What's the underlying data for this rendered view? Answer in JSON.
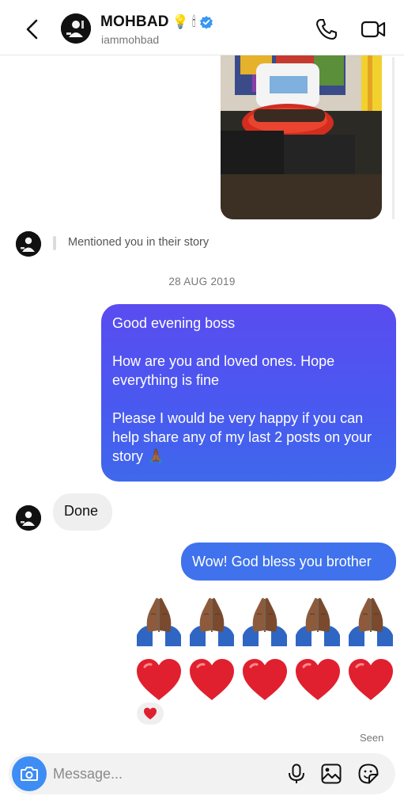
{
  "header": {
    "name": "MOHBAD",
    "name_emojis": [
      "💡",
      "🕯"
    ],
    "username": "iammohbad",
    "back_icon": "chevron-left-icon",
    "call_icon": "phone-icon",
    "video_icon": "video-camera-icon",
    "verified_color": "#3897f0"
  },
  "story": {
    "mention_text": "Mentioned you in their story"
  },
  "date_label": "28 AUG 2019",
  "messages": {
    "msg1": "Good evening boss\n\nHow are you and loved ones. Hope everything is fine\n\nPlease I would be very happy if you can help share any of my last 2 posts on your story 🙏🏾",
    "msg2": "Done",
    "msg3": "Wow! God bless you brother"
  },
  "emoji_rows": {
    "pray_count": 5,
    "heart_count": 5,
    "pray_icon": "praying-hands-icon",
    "heart_icon": "red-heart-icon"
  },
  "reaction": "❤️",
  "seen_label": "Seen",
  "composer": {
    "placeholder": "Message...",
    "camera_icon": "camera-icon",
    "mic_icon": "microphone-icon",
    "gallery_icon": "gallery-icon",
    "sticker_icon": "sticker-icon"
  },
  "colors": {
    "outgoing_bubble_top": "#5a4cf0",
    "outgoing_bubble_bottom": "#3f68ec",
    "incoming_bubble": "#efefef",
    "camera_button": "#3d8df5",
    "heart": "#e0202e"
  }
}
